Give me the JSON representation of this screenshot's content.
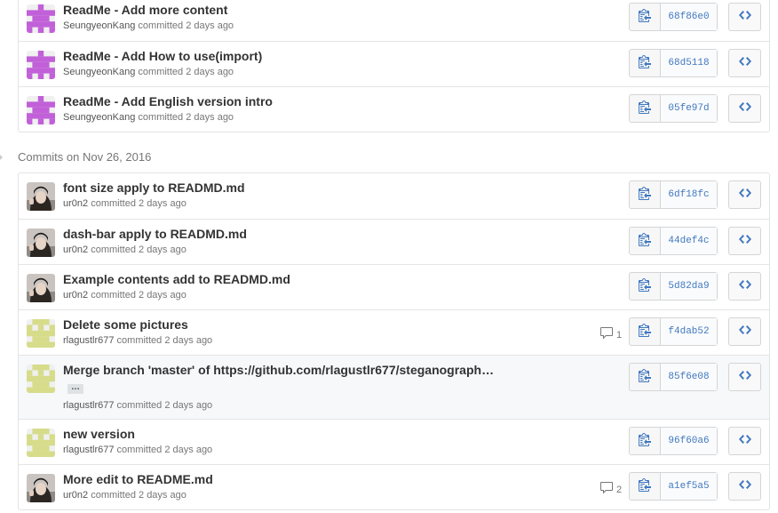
{
  "groups": [
    {
      "heading": "",
      "commits": [
        {
          "message": "ReadMe - Add more content",
          "author": "SeungyeonKang",
          "verb": "committed",
          "time": "2 days ago",
          "sha": "68f86e0",
          "avatar": "purple-identicon"
        },
        {
          "message": "ReadMe - Add How to use(import)",
          "author": "SeungyeonKang",
          "verb": "committed",
          "time": "2 days ago",
          "sha": "68d5118",
          "avatar": "purple-identicon"
        },
        {
          "message": "ReadMe - Add English version intro",
          "author": "SeungyeonKang",
          "verb": "committed",
          "time": "2 days ago",
          "sha": "05fe97d",
          "avatar": "purple-identicon"
        }
      ]
    },
    {
      "heading": "Commits on Nov 26, 2016",
      "commits": [
        {
          "message": "font size apply to READMD.md",
          "author": "ur0n2",
          "verb": "committed",
          "time": "2 days ago",
          "sha": "6df18fc",
          "avatar": "photo-avatar"
        },
        {
          "message": "dash-bar apply to READMD.md",
          "author": "ur0n2",
          "verb": "committed",
          "time": "2 days ago",
          "sha": "44def4c",
          "avatar": "photo-avatar"
        },
        {
          "message": "Example contents add to READMD.md",
          "author": "ur0n2",
          "verb": "committed",
          "time": "2 days ago",
          "sha": "5d82da9",
          "avatar": "photo-avatar"
        },
        {
          "message": "Delete some pictures",
          "author": "rlagustlr677",
          "verb": "committed",
          "time": "2 days ago",
          "sha": "f4dab52",
          "avatar": "yellow-identicon",
          "comments": "1"
        },
        {
          "message": "Merge branch 'master' of https://github.com/rlagustlr677/steganograph…",
          "author": "rlagustlr677",
          "verb": "committed",
          "time": "2 days ago",
          "sha": "85f6e08",
          "avatar": "yellow-identicon",
          "expander": "…"
        },
        {
          "message": "new version",
          "author": "rlagustlr677",
          "verb": "committed",
          "time": "2 days ago",
          "sha": "96f60a6",
          "avatar": "yellow-identicon"
        },
        {
          "message": "More edit to README.md",
          "author": "ur0n2",
          "verb": "committed",
          "time": "2 days ago",
          "sha": "a1ef5a5",
          "avatar": "photo-avatar",
          "comments": "2"
        }
      ]
    }
  ],
  "icons": {
    "copy": "clippy-icon",
    "browse": "code-icon",
    "comment": "comment-icon"
  },
  "colors": {
    "link": "#4078c0",
    "purple_identicon": "#c160d8",
    "yellow_identicon": "#d6dc8a"
  }
}
